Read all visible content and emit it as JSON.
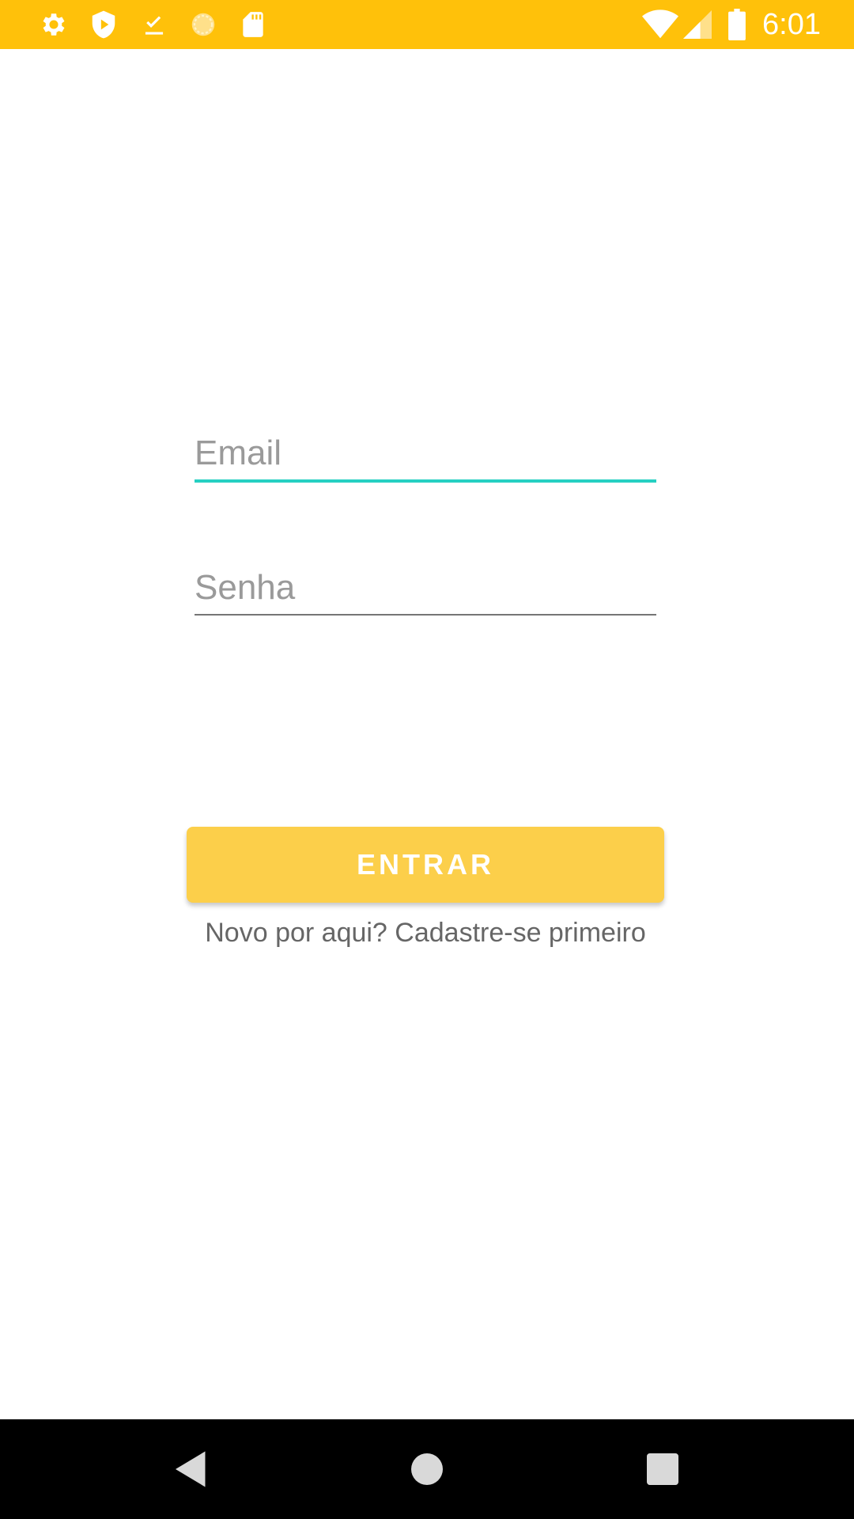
{
  "status_bar": {
    "time": "6:01",
    "background_color": "#FFC10A",
    "left_icons": [
      "gear-icon",
      "shield-play-icon",
      "download-done-icon",
      "sun-icon",
      "sd-card-icon"
    ],
    "right_icons": [
      "wifi-icon",
      "cell-signal-icon",
      "battery-icon"
    ]
  },
  "login_form": {
    "email_placeholder": "Email",
    "email_value": "",
    "email_underline_color": "#26D0C2",
    "password_placeholder": "Senha",
    "password_value": "",
    "password_underline_color": "#757575",
    "login_button_label": "ENTRAR",
    "login_button_color": "#FCCF4A",
    "signup_link": "Novo por aqui? Cadastre-se primeiro"
  },
  "nav_bar": {
    "buttons": [
      "back-icon",
      "home-icon",
      "recents-icon"
    ]
  }
}
